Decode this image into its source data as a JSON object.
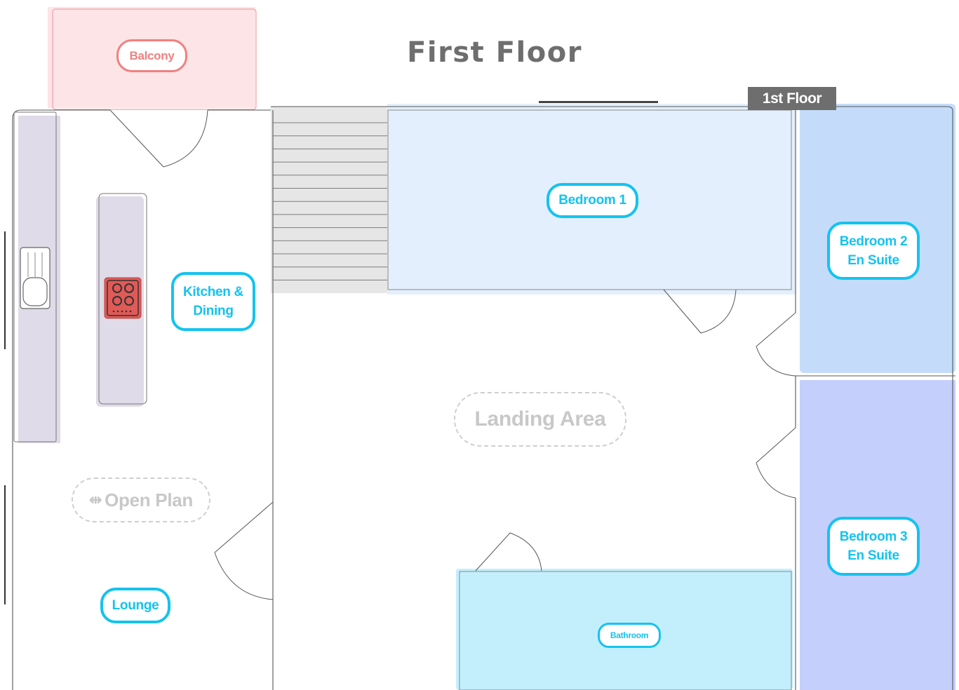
{
  "title": "First Floor",
  "floor_tag": "1st Floor",
  "rooms": {
    "balcony": "Balcony",
    "kitchen_line1": "Kitchen &",
    "kitchen_line2": "Dining",
    "open_plan_icon": "⇹",
    "open_plan": "Open Plan",
    "lounge": "Lounge",
    "landing": "Landing Area",
    "bedroom1": "Bedroom 1",
    "bedroom2_line1": "Bedroom 2",
    "bedroom2_line2": "En Suite",
    "bedroom3_line1": "Bedroom 3",
    "bedroom3_line2": "En Suite",
    "bathroom": "Bathroom"
  },
  "colors": {
    "label_blue": "#14c3ef",
    "balcony": "#fde4e6",
    "bedroom1": "#e3effc",
    "bedroom2": "#c4dcfa",
    "bedroom3": "#c4cffc",
    "bathroom": "#c3effd",
    "counter": "#e0dbe8",
    "hob": "#e05a57",
    "stairs": "#e6e6e6"
  }
}
